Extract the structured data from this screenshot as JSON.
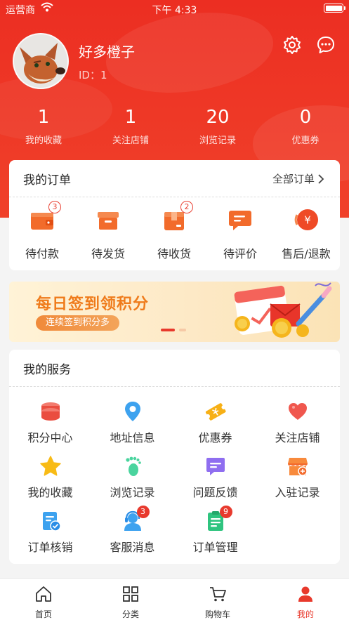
{
  "status_bar": {
    "carrier": "运营商",
    "time": "下午 4:33"
  },
  "profile": {
    "username": "好多橙子",
    "id_label": "ID：1"
  },
  "stats": [
    {
      "value": "1",
      "label": "我的收藏"
    },
    {
      "value": "1",
      "label": "关注店铺"
    },
    {
      "value": "20",
      "label": "浏览记录"
    },
    {
      "value": "0",
      "label": "优惠券"
    }
  ],
  "orders": {
    "title": "我的订单",
    "all_label": "全部订单",
    "items": [
      {
        "label": "待付款",
        "icon": "wallet-icon",
        "badge": "3"
      },
      {
        "label": "待发货",
        "icon": "box-icon",
        "badge": ""
      },
      {
        "label": "待收货",
        "icon": "package-icon",
        "badge": "2"
      },
      {
        "label": "待评价",
        "icon": "comment-icon",
        "badge": ""
      },
      {
        "label": "售后/退款",
        "icon": "refund-icon",
        "badge": ""
      }
    ],
    "refund_symbol": "¥"
  },
  "banner": {
    "title": "每日签到领积分",
    "subtitle": "连续签到积分多"
  },
  "services": {
    "title": "我的服务",
    "items": [
      {
        "label": "积分中心",
        "icon": "points-icon",
        "badge": ""
      },
      {
        "label": "地址信息",
        "icon": "location-icon",
        "badge": ""
      },
      {
        "label": "优惠券",
        "icon": "coupon-icon",
        "badge": ""
      },
      {
        "label": "关注店铺",
        "icon": "heart-icon",
        "badge": ""
      },
      {
        "label": "我的收藏",
        "icon": "star-icon",
        "badge": ""
      },
      {
        "label": "浏览记录",
        "icon": "footprint-icon",
        "badge": ""
      },
      {
        "label": "问题反馈",
        "icon": "feedback-icon",
        "badge": ""
      },
      {
        "label": "入驻记录",
        "icon": "shop-icon",
        "badge": ""
      },
      {
        "label": "订单核销",
        "icon": "verify-icon",
        "badge": ""
      },
      {
        "label": "客服消息",
        "icon": "service-icon",
        "badge": "3"
      },
      {
        "label": "订单管理",
        "icon": "order-list-icon",
        "badge": "9"
      }
    ]
  },
  "tabs": [
    {
      "label": "首页",
      "icon": "home-icon",
      "active": false
    },
    {
      "label": "分类",
      "icon": "category-icon",
      "active": false
    },
    {
      "label": "购物车",
      "icon": "cart-icon",
      "active": false
    },
    {
      "label": "我的",
      "icon": "user-icon",
      "active": true
    }
  ],
  "colors": {
    "brand_red": "#ec2e22",
    "orange": "#f26b2b",
    "badge_red": "#e83a2e"
  }
}
